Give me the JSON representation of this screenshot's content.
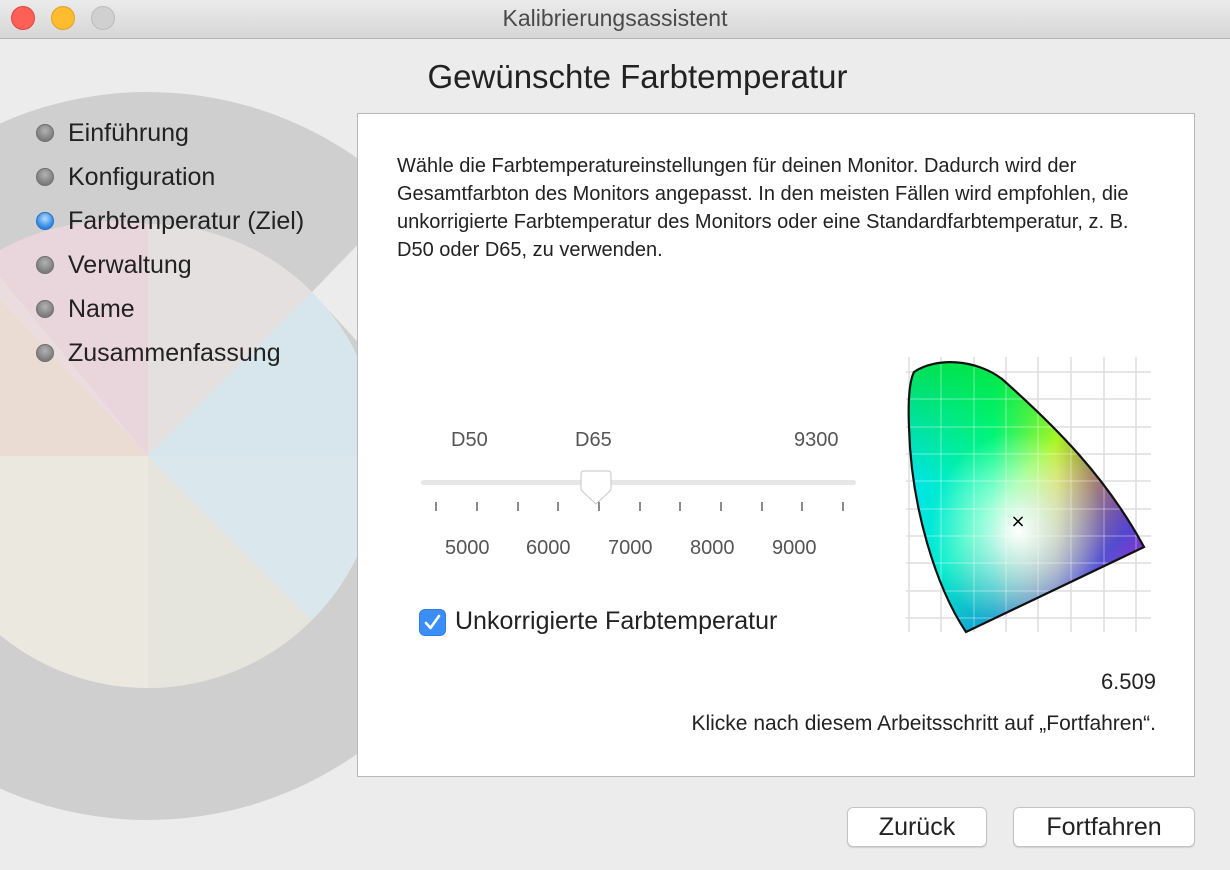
{
  "window": {
    "title": "Kalibrierungsassistent"
  },
  "page": {
    "title": "Gewünschte Farbtemperatur"
  },
  "sidebar": {
    "steps": [
      {
        "label": "Einführung",
        "state": "done"
      },
      {
        "label": "Konfiguration",
        "state": "done"
      },
      {
        "label": "Farbtemperatur (Ziel)",
        "state": "current"
      },
      {
        "label": "Verwaltung",
        "state": "pending"
      },
      {
        "label": "Name",
        "state": "pending"
      },
      {
        "label": "Zusammenfassung",
        "state": "pending"
      }
    ]
  },
  "panel": {
    "description": "Wähle die Farbtemperatureinstellungen für deinen Monitor. Dadurch wird der Gesamtfarbton des Monitors angepasst. In den meisten Fällen wird empfohlen, die unkorrigierte Farbtemperatur des Monitors oder eine Standardfarbtemperatur, z. B. D50 oder D65, zu verwenden.",
    "slider": {
      "presets": [
        "D50",
        "D65",
        "9300"
      ],
      "scale": [
        "5000",
        "6000",
        "7000",
        "8000",
        "9000"
      ],
      "value": 6509
    },
    "checkbox": {
      "label": "Unkorrigierte Farbtemperatur",
      "checked": true,
      "check_glyph": "✓"
    },
    "marker": "×",
    "current_value": "6.509",
    "hint": "Klicke nach diesem Arbeitsschritt auf „Fortfahren“."
  },
  "buttons": {
    "back": "Zurück",
    "continue": "Fortfahren"
  },
  "colors": {
    "accent": "#3a8ef6",
    "window_bg": "#ececec",
    "close": "#fe5f57",
    "minimize": "#febc2e"
  }
}
